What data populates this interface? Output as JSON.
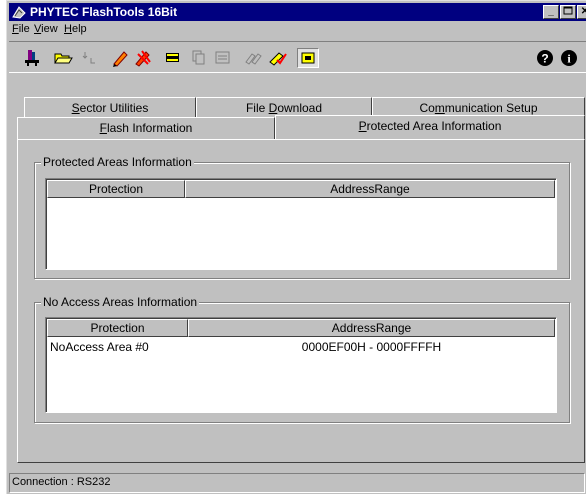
{
  "window": {
    "title": "PHYTEC FlashTools 16Bit"
  },
  "menu": {
    "file": {
      "hotkey": "F",
      "rest": "ile"
    },
    "view": {
      "hotkey": "V",
      "rest": "iew"
    },
    "help": {
      "hotkey": "H",
      "rest": "elp"
    }
  },
  "toolbar": {
    "icons": [
      "connect-icon",
      "open-file-icon",
      "download-icon",
      "pencil-icon",
      "erase-icon",
      "chip-icon",
      "copy-icon",
      "list-icon",
      "link-icon",
      "check-icon",
      "settings-icon",
      "help-icon",
      "info-icon"
    ]
  },
  "tabs": {
    "sector_utilities": {
      "pre": "",
      "hotkey": "S",
      "post": "ector Utilities"
    },
    "file_download": {
      "pre": "File ",
      "hotkey": "D",
      "post": "ownload"
    },
    "communication_setup": {
      "pre": "Co",
      "hotkey": "m",
      "post": "munication Setup"
    },
    "flash_information": {
      "pre": "",
      "hotkey": "F",
      "post": "lash Information"
    },
    "protected_area_information": {
      "pre": "",
      "hotkey": "P",
      "post": "rotected Area Information"
    }
  },
  "protected_areas": {
    "title": "Protected Areas Information",
    "columns": [
      "Protection",
      "AddressRange"
    ],
    "rows": []
  },
  "no_access_areas": {
    "title": "No Access Areas Information",
    "columns": [
      "Protection",
      "AddressRange"
    ],
    "rows": [
      {
        "protection": "NoAccess Area #0",
        "address_range": "0000EF00H - 0000FFFFH"
      }
    ]
  },
  "status": {
    "text": "Connection : RS232"
  },
  "colors": {
    "titlebar": "#000080",
    "face": "#c0c0c0"
  }
}
